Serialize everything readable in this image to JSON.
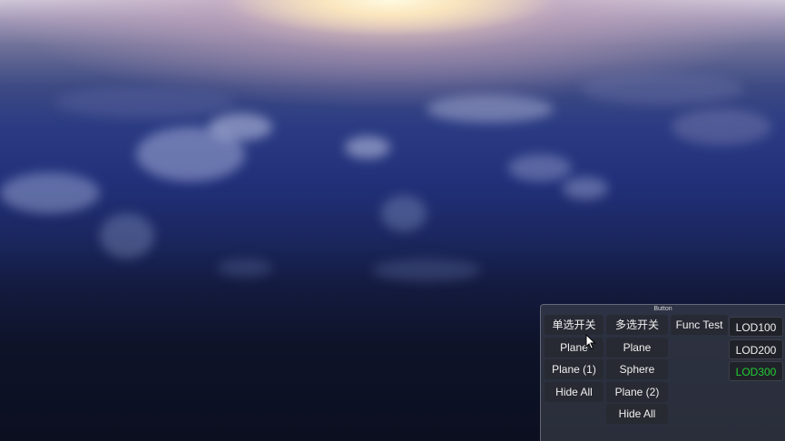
{
  "panel": {
    "title": "Button",
    "col1": [
      "单选开关",
      "Plane",
      "Plane (1)",
      "Hide All"
    ],
    "col2": [
      "多选开关",
      "Plane",
      "Sphere",
      "Plane (2)",
      "Hide All"
    ],
    "col3": [
      "Func Test"
    ],
    "lod": [
      "LOD100",
      "LOD200",
      "LOD300"
    ]
  },
  "colors": {
    "button_text": "#f0f0f0",
    "lod_active_text": "#22cc33"
  },
  "icons": {
    "cursor": "mouse-pointer-icon"
  }
}
